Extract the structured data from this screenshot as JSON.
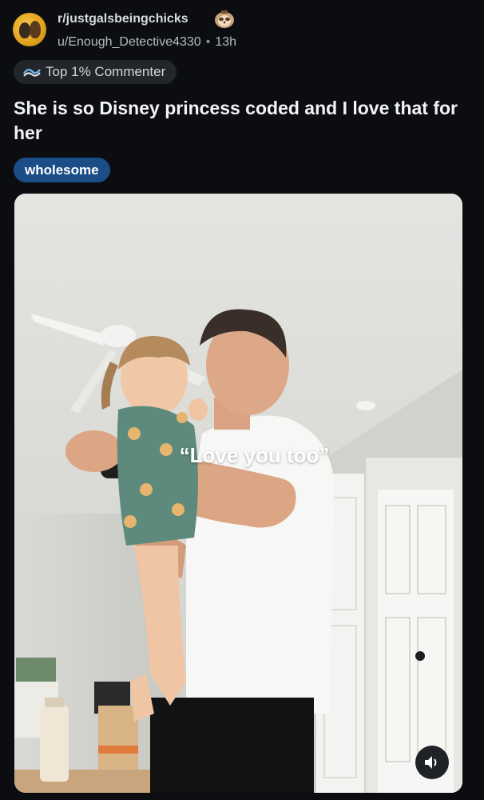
{
  "post": {
    "subreddit": "r/justgalsbeingchicks",
    "username": "u/Enough_Detective4330",
    "separator": "•",
    "age": "13h",
    "badge_label": "Top 1% Commenter",
    "badge_icon": "wave-icon",
    "title": "She is so Disney princess coded and I love that for her",
    "flair": "wholesome",
    "flair_color": "#1b4e86"
  },
  "media": {
    "overlay_caption": "“Love you too”",
    "audio_icon": "speaker-icon"
  },
  "colors": {
    "background": "#0b0d10",
    "badge_bg": "#22262b",
    "text_primary": "#f1f3f4",
    "text_secondary": "#b8bcc0"
  }
}
